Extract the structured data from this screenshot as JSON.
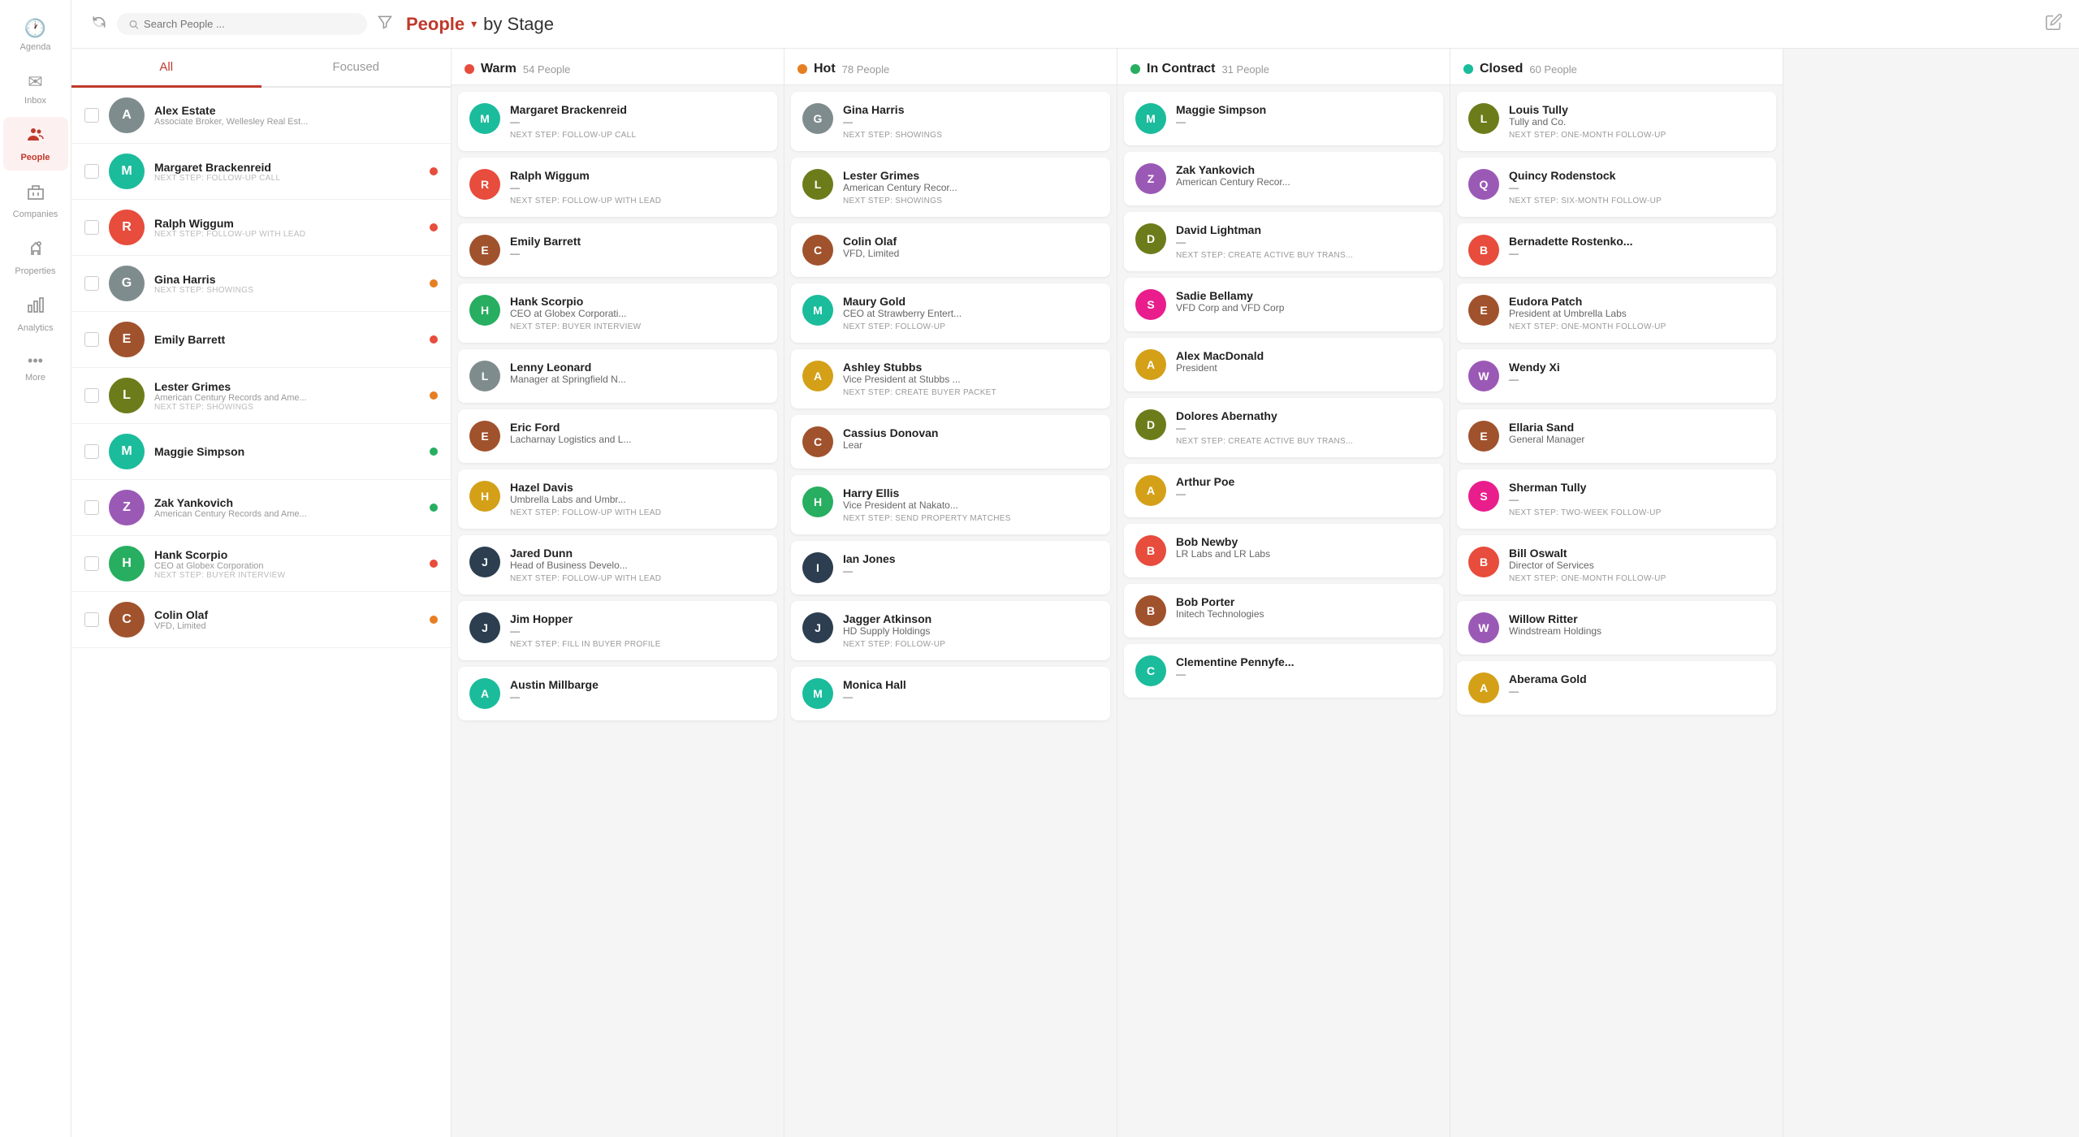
{
  "sidebar": {
    "items": [
      {
        "icon": "🕐",
        "label": "Agenda",
        "active": false
      },
      {
        "icon": "✉",
        "label": "Inbox",
        "active": false
      },
      {
        "icon": "👥",
        "label": "People",
        "active": true
      },
      {
        "icon": "🏢",
        "label": "Companies",
        "active": false
      },
      {
        "icon": "🏠",
        "label": "Properties",
        "active": false
      },
      {
        "icon": "📊",
        "label": "Analytics",
        "active": false
      },
      {
        "icon": "•••",
        "label": "More",
        "active": false
      }
    ]
  },
  "header": {
    "title": "People",
    "by_stage": "by Stage",
    "search_placeholder": "Search People ...",
    "refresh_label": "↻",
    "filter_label": "⛁",
    "edit_label": "✎"
  },
  "tabs": [
    {
      "label": "All",
      "active": true
    },
    {
      "label": "Focused",
      "active": false
    }
  ],
  "people_list": [
    {
      "name": "Alex Estate",
      "detail": "Associate Broker, Wellesley Real Est...",
      "next_step": "",
      "color": "c-gray",
      "initial": "A",
      "has_photo": true,
      "dot": "none"
    },
    {
      "name": "Margaret Brackenreid",
      "detail": "NEXT STEP: FOLLOW-UP CALL",
      "next_step": true,
      "color": "c-teal",
      "initial": "M",
      "dot": "red"
    },
    {
      "name": "Ralph Wiggum",
      "detail": "NEXT STEP: FOLLOW-UP WITH LEAD",
      "next_step": true,
      "color": "c-red",
      "initial": "R",
      "dot": "red"
    },
    {
      "name": "Gina Harris",
      "detail": "NEXT STEP: SHOWINGS",
      "next_step": true,
      "color": "c-gray",
      "initial": "G",
      "has_photo": true,
      "dot": "orange"
    },
    {
      "name": "Emily Barrett",
      "detail": "",
      "next_step": false,
      "color": "c-brown",
      "initial": "E",
      "dot": "red"
    },
    {
      "name": "Lester Grimes",
      "detail": "American Century Records and Ame...",
      "next_step_text": "NEXT STEP: SHOWINGS",
      "color": "c-olive",
      "initial": "L",
      "dot": "orange"
    },
    {
      "name": "Maggie Simpson",
      "detail": "",
      "next_step": false,
      "color": "c-teal",
      "initial": "M",
      "dot": "green"
    },
    {
      "name": "Zak Yankovich",
      "detail": "American Century Records and Ame...",
      "next_step_text": "",
      "color": "c-purple",
      "initial": "Z",
      "dot": "green"
    },
    {
      "name": "Hank Scorpio",
      "detail": "CEO at Globex Corporation",
      "next_step_text": "NEXT STEP: BUYER INTERVIEW",
      "color": "c-green",
      "initial": "H",
      "dot": "red"
    },
    {
      "name": "Colin Olaf",
      "detail": "VFD, Limited",
      "next_step": false,
      "color": "c-brown",
      "initial": "C",
      "dot": "orange"
    }
  ],
  "columns": [
    {
      "title": "Warm",
      "count": "54 People",
      "dot_color": "#e74c3c",
      "cards": [
        {
          "name": "Margaret Brackenreid",
          "company": "—",
          "next_step": "NEXT STEP: FOLLOW-UP CALL",
          "color": "c-teal",
          "initial": "M"
        },
        {
          "name": "Ralph Wiggum",
          "company": "—",
          "next_step": "NEXT STEP: FOLLOW-UP WITH LEAD",
          "color": "c-red",
          "initial": "R"
        },
        {
          "name": "Emily Barrett",
          "company": "—",
          "next_step": "",
          "color": "c-brown",
          "initial": "E"
        },
        {
          "name": "Hank Scorpio",
          "company": "CEO at Globex Corporati...",
          "next_step": "NEXT STEP: BUYER INTERVIEW",
          "color": "c-green",
          "initial": "H"
        },
        {
          "name": "Lenny Leonard",
          "company": "Manager at Springfield N...",
          "next_step": "",
          "color": "c-gray",
          "initial": "L",
          "has_photo": true
        },
        {
          "name": "Eric Ford",
          "company": "Lacharnay Logistics and L...",
          "next_step": "",
          "color": "c-brown",
          "initial": "E"
        },
        {
          "name": "Hazel Davis",
          "company": "Umbrella Labs and Umbr...",
          "next_step": "NEXT STEP: FOLLOW-UP WITH LEAD",
          "color": "c-amber",
          "initial": "H"
        },
        {
          "name": "Jared Dunn",
          "company": "Head of Business Develo...",
          "next_step": "NEXT STEP: FOLLOW-UP WITH LEAD",
          "color": "c-navy",
          "initial": "J"
        },
        {
          "name": "Jim Hopper",
          "company": "—",
          "next_step": "NEXT STEP: FILL IN BUYER PROFILE",
          "color": "c-navy",
          "initial": "J"
        },
        {
          "name": "Austin Millbarge",
          "company": "—",
          "next_step": "",
          "color": "c-teal",
          "initial": "A"
        }
      ]
    },
    {
      "title": "Hot",
      "count": "78 People",
      "dot_color": "#e67e22",
      "cards": [
        {
          "name": "Gina Harris",
          "company": "—",
          "next_step": "NEXT STEP: SHOWINGS",
          "color": "c-gray",
          "initial": "G",
          "has_photo": true
        },
        {
          "name": "Lester Grimes",
          "company": "American Century Recor...",
          "next_step": "NEXT STEP: SHOWINGS",
          "color": "c-olive",
          "initial": "L"
        },
        {
          "name": "Colin Olaf",
          "company": "VFD, Limited",
          "next_step": "",
          "color": "c-brown",
          "initial": "C"
        },
        {
          "name": "Maury Gold",
          "company": "CEO at Strawberry Entert...",
          "next_step": "NEXT STEP: FOLLOW-UP",
          "color": "c-teal",
          "initial": "M"
        },
        {
          "name": "Ashley Stubbs",
          "company": "Vice President at Stubbs ...",
          "next_step": "NEXT STEP: CREATE BUYER PACKET",
          "color": "c-amber",
          "initial": "A"
        },
        {
          "name": "Cassius Donovan",
          "company": "Lear",
          "next_step": "",
          "color": "c-brown",
          "initial": "C"
        },
        {
          "name": "Harry Ellis",
          "company": "Vice President at Nakato...",
          "next_step": "NEXT STEP: SEND PROPERTY MATCHES",
          "color": "c-green",
          "initial": "H"
        },
        {
          "name": "Ian Jones",
          "company": "—",
          "next_step": "",
          "color": "c-navy",
          "initial": "I"
        },
        {
          "name": "Jagger Atkinson",
          "company": "HD Supply Holdings",
          "next_step": "NEXT STEP: FOLLOW-UP",
          "color": "c-navy",
          "initial": "J"
        },
        {
          "name": "Monica Hall",
          "company": "—",
          "next_step": "",
          "color": "c-teal",
          "initial": "M"
        }
      ]
    },
    {
      "title": "In Contract",
      "count": "31 People",
      "dot_color": "#27ae60",
      "cards": [
        {
          "name": "Maggie Simpson",
          "company": "—",
          "next_step": "",
          "color": "c-teal",
          "initial": "M"
        },
        {
          "name": "Zak Yankovich",
          "company": "American Century Recor...",
          "next_step": "",
          "color": "c-purple",
          "initial": "Z"
        },
        {
          "name": "David Lightman",
          "company": "—",
          "next_step": "NEXT STEP: CREATE ACTIVE BUY TRANS...",
          "color": "c-olive",
          "initial": "D"
        },
        {
          "name": "Sadie Bellamy",
          "company": "VFD Corp and VFD Corp",
          "next_step": "",
          "color": "c-pink",
          "initial": "S"
        },
        {
          "name": "Alex MacDonald",
          "company": "President",
          "next_step": "",
          "color": "c-amber",
          "initial": "A"
        },
        {
          "name": "Dolores Abernathy",
          "company": "—",
          "next_step": "NEXT STEP: CREATE ACTIVE BUY TRANS...",
          "color": "c-olive",
          "initial": "D"
        },
        {
          "name": "Arthur Poe",
          "company": "—",
          "next_step": "",
          "color": "c-amber",
          "initial": "A"
        },
        {
          "name": "Bob Newby",
          "company": "LR Labs and LR Labs",
          "next_step": "",
          "color": "c-red",
          "initial": "B"
        },
        {
          "name": "Bob Porter",
          "company": "Initech Technologies",
          "next_step": "",
          "color": "c-brown",
          "initial": "B"
        },
        {
          "name": "Clementine Pennyfe...",
          "company": "—",
          "next_step": "",
          "color": "c-teal",
          "initial": "C"
        }
      ]
    },
    {
      "title": "Closed",
      "count": "60 People",
      "dot_color": "#1abc9c",
      "cards": [
        {
          "name": "Louis Tully",
          "company": "Tully and Co.",
          "next_step": "NEXT STEP: ONE-MONTH FOLLOW-UP",
          "color": "c-olive",
          "initial": "L"
        },
        {
          "name": "Quincy Rodenstock",
          "company": "—",
          "next_step": "NEXT STEP: SIX-MONTH FOLLOW-UP",
          "color": "c-purple",
          "initial": "Q"
        },
        {
          "name": "Bernadette Rostenko...",
          "company": "—",
          "next_step": "",
          "color": "c-red",
          "initial": "B"
        },
        {
          "name": "Eudora Patch",
          "company": "President at Umbrella Labs",
          "next_step": "NEXT STEP: ONE-MONTH FOLLOW-UP",
          "color": "c-brown",
          "initial": "E"
        },
        {
          "name": "Wendy Xi",
          "company": "—",
          "next_step": "",
          "color": "c-purple",
          "initial": "W"
        },
        {
          "name": "Ellaria Sand",
          "company": "General Manager",
          "next_step": "",
          "color": "c-brown",
          "initial": "E"
        },
        {
          "name": "Sherman Tully",
          "company": "—",
          "next_step": "NEXT STEP: TWO-WEEK FOLLOW-UP",
          "color": "c-pink",
          "initial": "S"
        },
        {
          "name": "Bill Oswalt",
          "company": "Director of Services",
          "next_step": "NEXT STEP: ONE-MONTH FOLLOW-UP",
          "color": "c-red",
          "initial": "B"
        },
        {
          "name": "Willow Ritter",
          "company": "Windstream Holdings",
          "next_step": "",
          "color": "c-purple",
          "initial": "W"
        },
        {
          "name": "Aberama Gold",
          "company": "—",
          "next_step": "",
          "color": "c-amber",
          "initial": "A"
        }
      ]
    }
  ]
}
